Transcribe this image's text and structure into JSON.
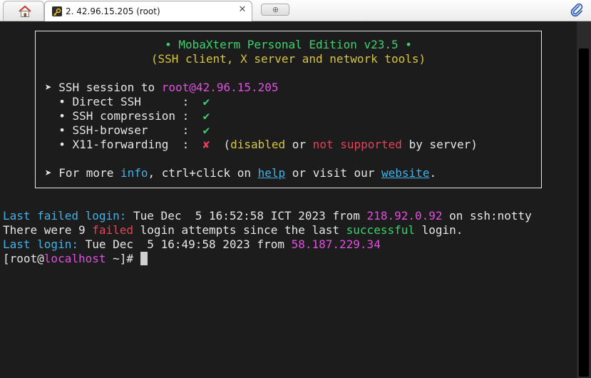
{
  "tabs": {
    "session_title": "2. 42.96.15.205 (root)",
    "close_glyph": "✕",
    "new_tab_glyph": "⊕"
  },
  "banner": {
    "title": "• MobaXterm Personal Edition v23.5 •",
    "subtitle": "(SSH client, X server and network tools)",
    "session_prefix": "➤ SSH session to ",
    "session_target": "root@42.96.15.205",
    "items": [
      {
        "label": "  • Direct SSH      :  ",
        "mark": "✔",
        "mark_type": "check"
      },
      {
        "label": "  • SSH compression :  ",
        "mark": "✔",
        "mark_type": "check"
      },
      {
        "label": "  • SSH-browser     :  ",
        "mark": "✔",
        "mark_type": "check"
      },
      {
        "label": "  • X11-forwarding  :  ",
        "mark": "✘",
        "mark_type": "cross"
      }
    ],
    "x11_note": {
      "open": "  (",
      "disabled": "disabled",
      "or": " or ",
      "not_supported": "not supported",
      "tail": " by server)"
    },
    "more": {
      "prefix": "➤ For more ",
      "info": "info",
      "middle": ", ctrl+click on ",
      "help": "help",
      "visit": " or visit our ",
      "website": "website",
      "end": "."
    }
  },
  "terminal": {
    "line1": {
      "label": "Last failed login:",
      "text": " Tue Dec  5 16:52:58 ICT 2023 from ",
      "ip": "218.92.0.92",
      "tail": " on ssh:notty"
    },
    "line2": {
      "a": "There were 9 ",
      "failed": "failed",
      "b": " login attempts since the last ",
      "successful": "successful",
      "c": " login."
    },
    "line3": {
      "label": "Last login:",
      "text": " Tue Dec  5 16:49:58 2023 from ",
      "ip": "58.187.229.34"
    },
    "prompt": {
      "open": "[root@",
      "host": "localhost",
      "tail": " ~]# "
    }
  },
  "colors": {
    "background": "#1c1c1c",
    "green": "#3fd16f",
    "yellow": "#d6c545",
    "magenta": "#e14fe1",
    "cyan": "#43b0e6",
    "red": "#e2445a"
  }
}
